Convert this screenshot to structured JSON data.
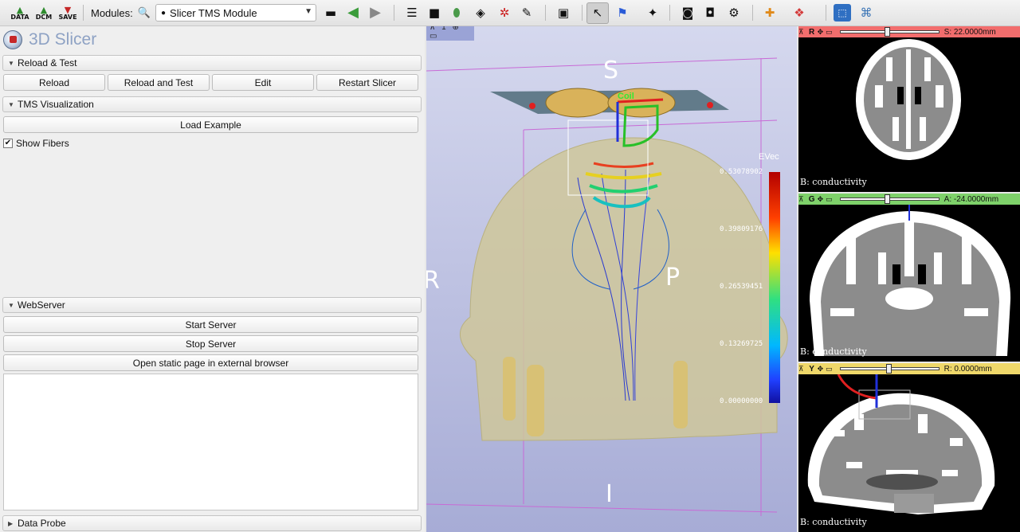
{
  "toolbar": {
    "load_data": "DATA",
    "load_dicom": "DCM",
    "save": "SAVE",
    "modules_label": "Modules:",
    "selected_module": "Slicer TMS Module"
  },
  "brand": {
    "title": "3D Slicer"
  },
  "sections": {
    "reload_test": {
      "title": "Reload & Test",
      "buttons": [
        "Reload",
        "Reload and Test",
        "Edit",
        "Restart Slicer"
      ]
    },
    "tms_visualization": {
      "title": "TMS Visualization",
      "load_example": "Load Example",
      "show_fibers": "Show Fibers",
      "show_fibers_checked": true
    },
    "webserver": {
      "title": "WebServer",
      "start": "Start Server",
      "stop": "Stop Server",
      "open_static": "Open static page in external browser"
    },
    "data_probe": {
      "title": "Data Probe"
    }
  },
  "view3d": {
    "number": "1",
    "orientation": {
      "superior": "S",
      "inferior": "I",
      "right": "R",
      "posterior": "P"
    },
    "coil_label": "Coil",
    "colorbar": {
      "title": "EVec",
      "ticks": [
        "0.53078902",
        "0.39809176",
        "0.26539451",
        "0.13269725",
        "0.00000000"
      ]
    }
  },
  "slices": {
    "red": {
      "name": "R",
      "value": "S: 22.0000mm",
      "layer": "B: conductivity",
      "offset": 0.48,
      "color": "#f26d6d"
    },
    "green": {
      "name": "G",
      "value": "A: -24.0000mm",
      "layer": "B: conductivity",
      "offset": 0.48,
      "color": "#7ed16a"
    },
    "yellow": {
      "name": "Y",
      "value": "R: 0.0000mm",
      "layer": "B: conductivity",
      "offset": 0.5,
      "color": "#efd86a"
    }
  }
}
